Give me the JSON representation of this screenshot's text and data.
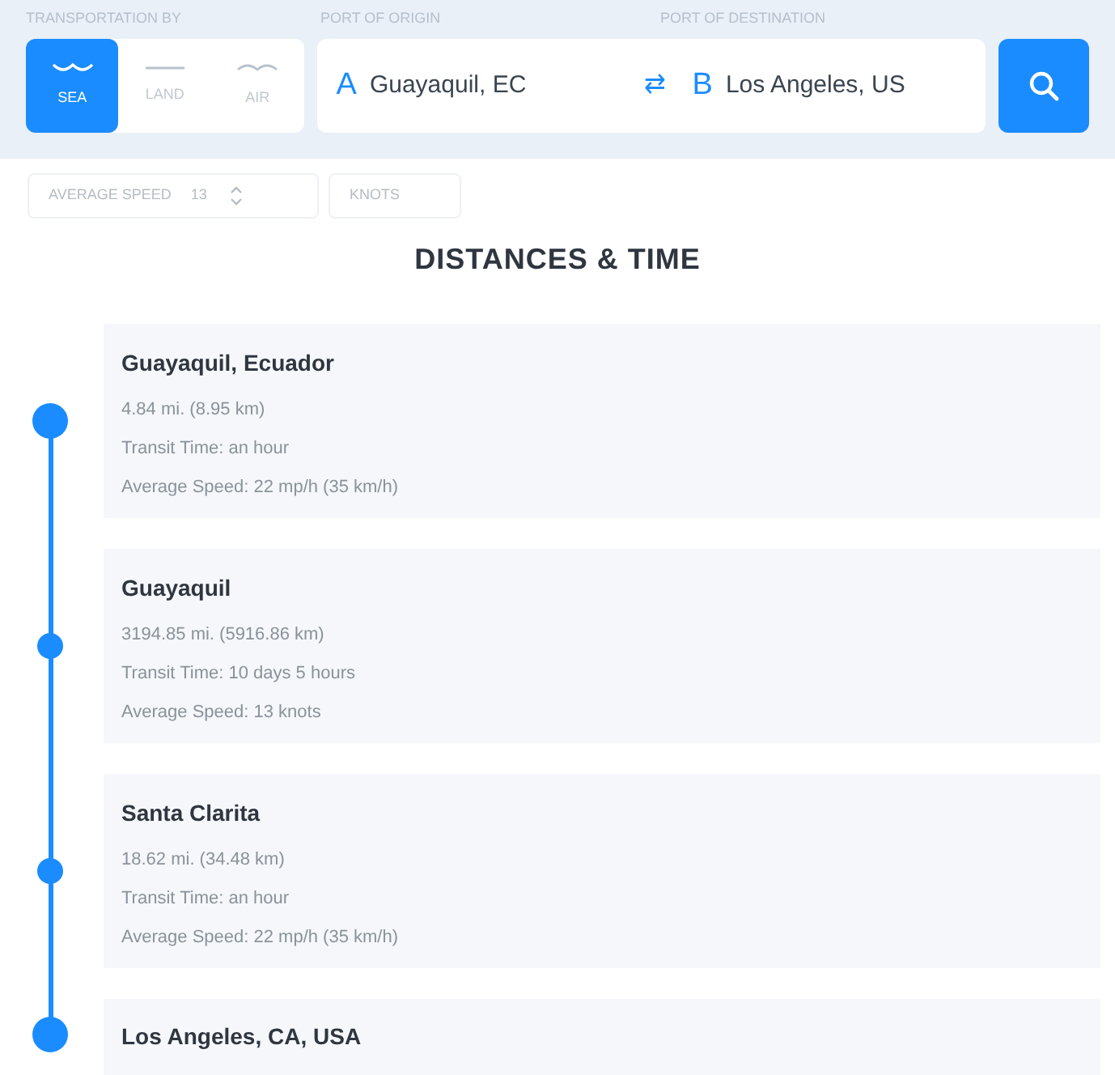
{
  "search_bar": {
    "transport_label": "TRANSPORTATION BY",
    "origin_label": "PORT OF ORIGIN",
    "destination_label": "PORT OF DESTINATION",
    "modes": [
      {
        "label": "SEA",
        "kind": "sea",
        "selected": true
      },
      {
        "label": "LAND",
        "kind": "land",
        "selected": false
      },
      {
        "label": "AIR",
        "kind": "air",
        "selected": false
      }
    ],
    "origin": {
      "letter": "A",
      "value": "Guayaquil, EC"
    },
    "swap": "⇄",
    "destination": {
      "letter": "B",
      "value": "Los Angeles, US"
    }
  },
  "speed": {
    "label": "AVERAGE SPEED",
    "value": "13",
    "unit": "KNOTS"
  },
  "title": "DISTANCES & TIME",
  "stops": [
    {
      "kind": "endpoint",
      "name": "Guayaquil, Ecuador",
      "lines": [
        "4.84 mi. (8.95 km)",
        "Transit Time: an hour",
        "Average Speed: 22 mp/h (35 km/h)"
      ]
    },
    {
      "kind": "waypoint",
      "name": "Guayaquil",
      "lines": [
        "3194.85 mi. (5916.86 km)",
        "Transit Time: 10 days 5 hours",
        "Average Speed: 13 knots"
      ]
    },
    {
      "kind": "waypoint",
      "name": "Santa Clarita",
      "lines": [
        "18.62 mi. (34.48 km)",
        "Transit Time: an hour",
        "Average Speed: 22 mp/h (35 km/h)"
      ]
    },
    {
      "kind": "endpoint",
      "name": "Los Angeles, CA, USA"
    }
  ]
}
